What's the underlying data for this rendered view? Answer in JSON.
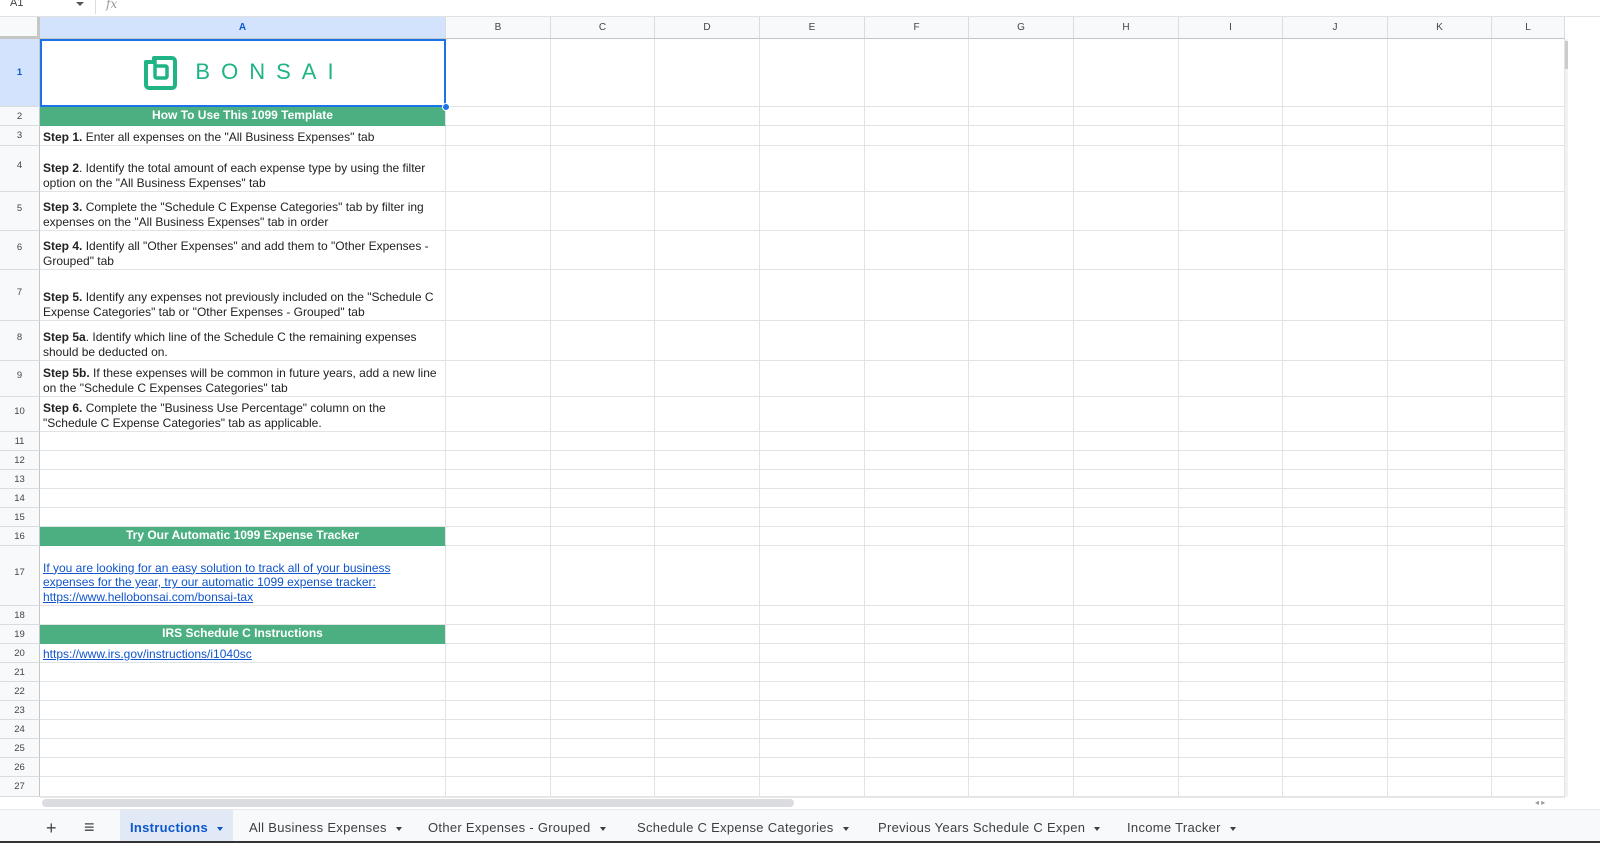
{
  "formula_bar": {
    "name_box": "A1",
    "fx_label": "fx"
  },
  "columns": [
    "A",
    "B",
    "C",
    "D",
    "E",
    "F",
    "G",
    "H",
    "I",
    "J",
    "K",
    "L"
  ],
  "rows": [
    "1",
    "2",
    "3",
    "4",
    "5",
    "6",
    "7",
    "8",
    "9",
    "10",
    "11",
    "12",
    "13",
    "14",
    "15",
    "16",
    "17",
    "18",
    "19",
    "20",
    "21",
    "22",
    "23",
    "24",
    "25",
    "26",
    "27"
  ],
  "logo": {
    "text": "BONSAI",
    "color": "#20b386"
  },
  "header_color": "#4caf82",
  "cells": {
    "a2": "How To Use This 1099 Template",
    "a3": {
      "bold": "Step 1.",
      "text": " Enter all expenses on the \"All Business Expenses\" tab"
    },
    "a4": {
      "bold": "Step 2",
      "text": ". Identify the total amount of each expense type by using the filter option on the \"All Business Expenses\" tab"
    },
    "a5": {
      "bold": "Step 3.",
      "text": " Complete the \"Schedule C Expense Categories\" tab by filter ing expenses on the \"All Business Expenses\" tab in order"
    },
    "a6": {
      "bold": "Step 4.",
      "text": " Identify all \"Other Expenses\" and add them to \"Other Expenses - Grouped\" tab"
    },
    "a7": {
      "bold": "Step 5.",
      "text": " Identify any expenses not previously included on the \"Schedule C Expense Categories\" tab or \"Other Expenses - Grouped\" tab"
    },
    "a8": {
      "bold": "Step 5a",
      "text": ". Identify which line of the Schedule C the remaining expenses should be deducted on."
    },
    "a9": {
      "bold": "Step 5b.",
      "text": " If these expenses will be common in future years, add a new line on the \"Schedule C Expenses Categories\" tab"
    },
    "a10": {
      "bold": "Step 6.",
      "text": " Complete the \"Business Use Percentage\" column on the \"Schedule C Expense Categories\" tab as applicable."
    },
    "a16": "Try Our Automatic 1099 Expense Tracker",
    "a17": "If you are looking for an easy solution to track all of your business expenses for the year, try our automatic 1099 expense tracker: https://www.hellobonsai.com/bonsai-tax",
    "a19": "IRS Schedule C Instructions",
    "a20": "https://www.irs.gov/instructions/i1040sc"
  },
  "sheet_tabs": [
    {
      "label": "Instructions",
      "active": true
    },
    {
      "label": "All Business Expenses",
      "active": false
    },
    {
      "label": "Other Expenses - Grouped",
      "active": false
    },
    {
      "label": "Schedule C Expense Categories",
      "active": false
    },
    {
      "label": "Previous Years Schedule C Expen",
      "active": false
    },
    {
      "label": "Income Tracker",
      "active": false
    }
  ],
  "tab_controls": {
    "add": "+",
    "menu": "≡"
  }
}
